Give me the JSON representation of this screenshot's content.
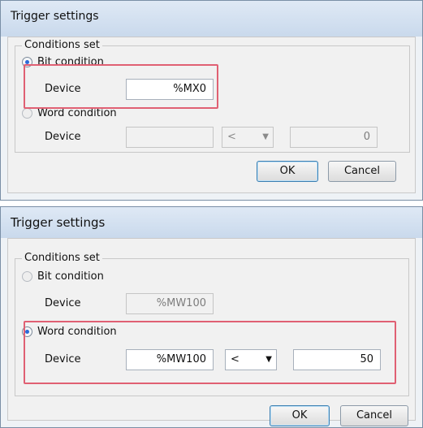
{
  "dialog1": {
    "title": "Trigger settings",
    "group_legend": "Conditions set",
    "bit_label": "Bit condition",
    "bit_device_label": "Device",
    "bit_device_value": "%MX0",
    "word_label": "Word condition",
    "word_device_label": "Device",
    "word_device_value": "",
    "operator": "<",
    "word_value": "0",
    "ok_label": "OK",
    "cancel_label": "Cancel"
  },
  "dialog2": {
    "title": "Trigger settings",
    "group_legend": "Conditions set",
    "bit_label": "Bit condition",
    "bit_device_label": "Device",
    "bit_device_value": "%MW100",
    "word_label": "Word condition",
    "word_device_label": "Device",
    "word_device_value": "%MW100",
    "operator": "<",
    "word_value": "50",
    "ok_label": "OK",
    "cancel_label": "Cancel"
  },
  "icons": {
    "dropdown": "chevron-down-icon"
  },
  "colors": {
    "highlight": "#e06073",
    "radio_selected": "#2b6ad8"
  }
}
